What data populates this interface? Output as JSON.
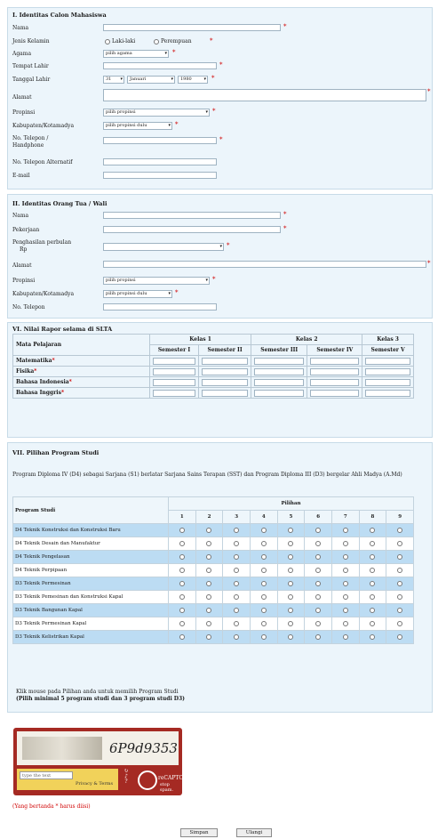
{
  "section1": {
    "title": "I. Identitas Calon Mahasiswa",
    "nama": "Nama",
    "jenis_kelamin": "Jenis Kelamin",
    "laki": "Laki-laki",
    "perempuan": "Perempuan",
    "agama": "Agama",
    "agama_value": "pilih agama",
    "tempat_lahir": "Tempat Lahir",
    "tanggal_lahir": "Tanggal Lahir",
    "tgl_value": "31",
    "bulan_value": "Januari",
    "tahun_value": "1980",
    "alamat": "Alamat",
    "propinsi": "Propinsi",
    "propinsi_value": "pilih propinsi",
    "kabupaten": "Kabupaten/Kotamadya",
    "kabupaten_value": "pilih propinsi dulu",
    "telepon": "No. Telepon /",
    "telepon2": "Handphone",
    "telepon_alt": "No. Telepon Alternatif",
    "email": "E-mail"
  },
  "section2": {
    "title": "II. Identitas Orang Tua / Wali",
    "nama": "Nama",
    "pekerjaan": "Pekerjaan",
    "penghasilan": "Penghasilan perbulan",
    "penghasilan2": "Rp",
    "alamat": "Alamat",
    "propinsi": "Propinsi",
    "propinsi_value": "pilih propinsi",
    "kabupaten": "Kabupaten/Kotamadya",
    "kabupaten_value": "pilih propinsi dulu",
    "telepon": "No. Telepon"
  },
  "section6": {
    "title": "VI. Nilai Rapor selama di SLTA",
    "mata_pelajaran": "Mata Pelajaran",
    "kelas": [
      "Kelas 1",
      "Kelas 2",
      "Kelas 3"
    ],
    "semesters": [
      "Semester I",
      "Semester II",
      "Semester III",
      "Semester IV",
      "Semester V"
    ],
    "subjects": [
      "Matematika",
      "Fisika",
      "Bahasa Indonesia",
      "Bahasa Inggris"
    ]
  },
  "section7": {
    "title": "VII. Pilihan Program Studi",
    "intro": "Program Diploma IV (D4) sebagai Sarjana (S1) berlatar Sarjana Sains Terapan (SST) dan Program Diploma III (D3) bergelar Ahli Madya (A.Md)",
    "program_studi": "Program Studi",
    "pilihan": "Pilihan",
    "choices": [
      "1",
      "2",
      "3",
      "4",
      "5",
      "6",
      "7",
      "8",
      "9"
    ],
    "programs": [
      "D4 Teknik Konstruksi dan Konstruksi Baru",
      "D4 Teknik Desain dan Manufaktur",
      "D4 Teknik Pengelasan",
      "D4 Teknik Perpipaan",
      "D3 Teknik Permesinan",
      "D3 Teknik Pemesinan dan Konstruksi Kapal",
      "D3 Teknik Bangunan Kapal",
      "D3 Teknik Permesinan Kapal",
      "D3 Teknik Kelistrikan Kapal"
    ],
    "note1": "Klik mouse pada Pilihan anda untuk memilih Program Studi",
    "note2": "(Pilih minimal 5 program studi dan 3 program studi D3)"
  },
  "captcha": {
    "code": "6P9d9353",
    "input_placeholder": "type the text",
    "privacy": "Privacy & Terms",
    "brand": "reCAPTCHA",
    "brand_sub": "stop spam."
  },
  "footer": {
    "required_note": "(Yang bertanda * harus diisi)",
    "submit": "Simpan",
    "reset": "Ulangi"
  },
  "colors": {
    "panel": "#ecf5fb",
    "highlight_row": "#bcdcf3",
    "required": "#d00000",
    "captcha_frame": "#a52a23"
  }
}
